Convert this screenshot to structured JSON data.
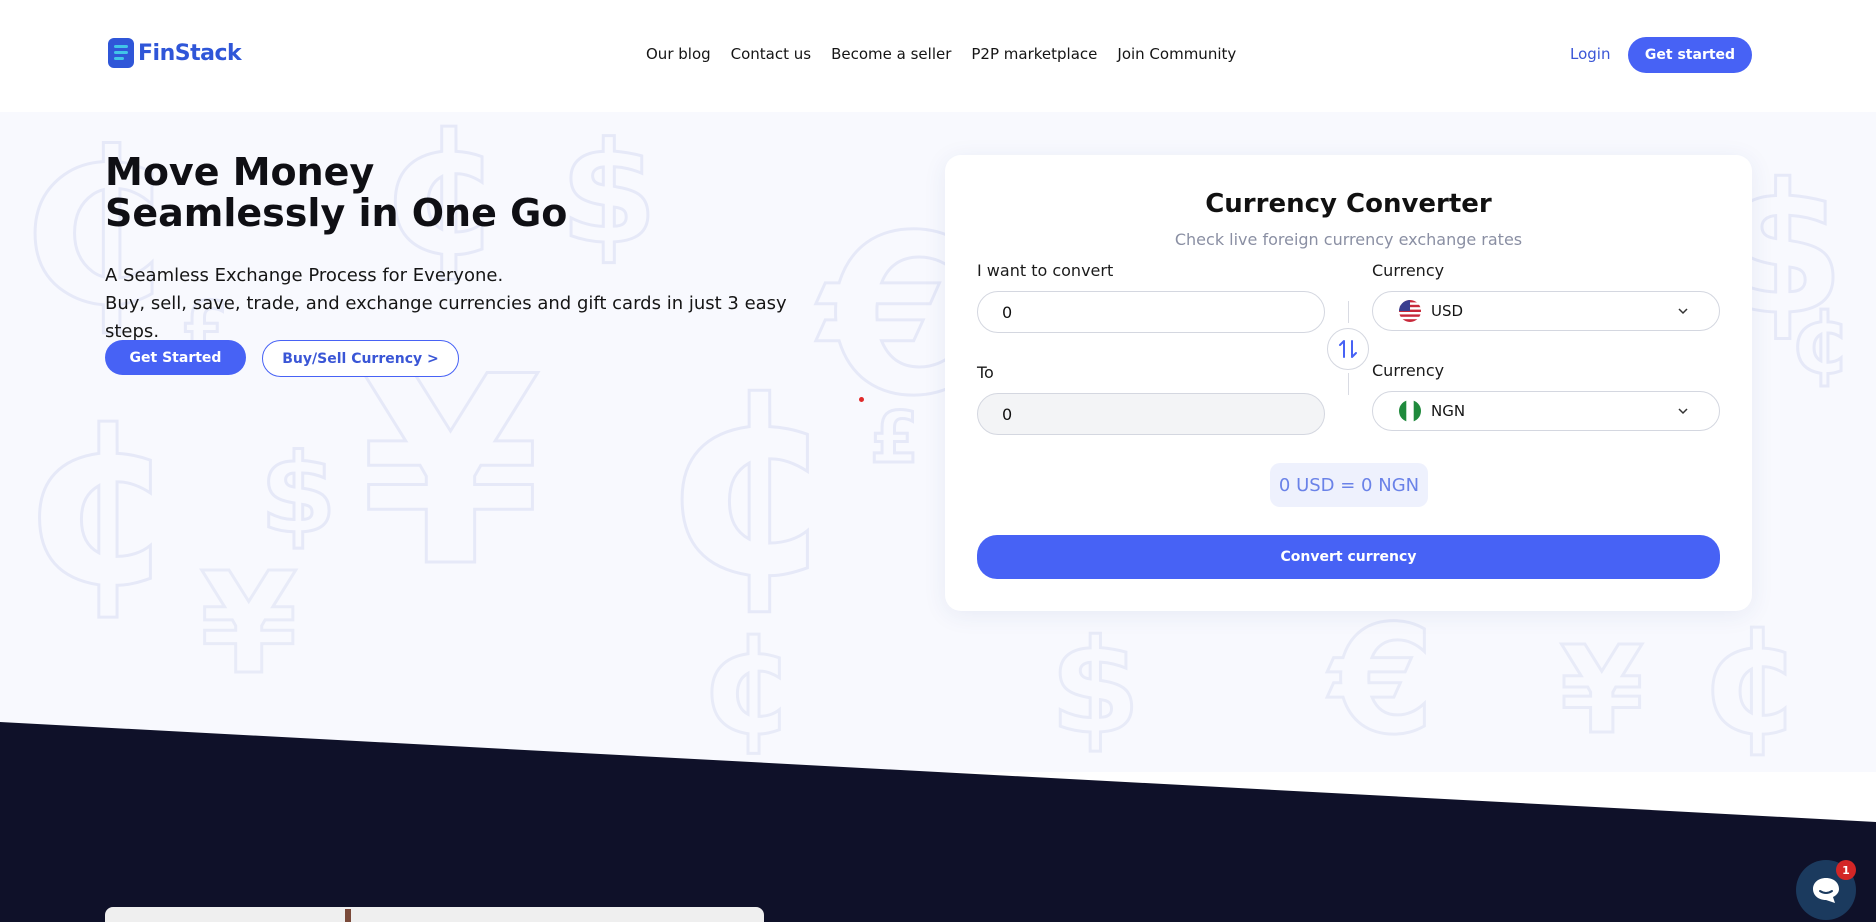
{
  "brand": {
    "name": "FinStack",
    "color": "#2f56d8"
  },
  "nav": {
    "items": [
      "Our blog",
      "Contact us",
      "Become a seller",
      "P2P marketplace",
      "Join Community"
    ],
    "login": "Login",
    "get_started": "Get started"
  },
  "hero": {
    "title": "Move Money Seamlessly in One Go",
    "subtitle_line1": "A Seamless Exchange Process for Everyone.",
    "subtitle_line2": "Buy, sell, save, trade, and exchange currencies and gift cards in just 3 easy steps.",
    "primary_cta": "Get Started",
    "secondary_cta": "Buy/Sell Currency >"
  },
  "converter": {
    "title": "Currency Converter",
    "subtitle": "Check live foreign currency exchange rates",
    "from_label": "I want to convert",
    "from_value": "0",
    "from_currency_label": "Currency",
    "from_currency": "USD",
    "to_label": "To",
    "to_value": "0",
    "to_currency_label": "Currency",
    "to_currency": "NGN",
    "rate_text": "0 USD = 0 NGN",
    "convert_button": "Convert currency"
  },
  "chat": {
    "unread_count": "1"
  },
  "colors": {
    "accent": "#4762f5",
    "dark_section": "#0f1129",
    "hero_bg": "#f8f9fe"
  },
  "icons": [
    "logo-icon",
    "us-flag-icon",
    "ng-flag-icon",
    "chevron-down-icon",
    "swap-icon",
    "chat-icon"
  ]
}
